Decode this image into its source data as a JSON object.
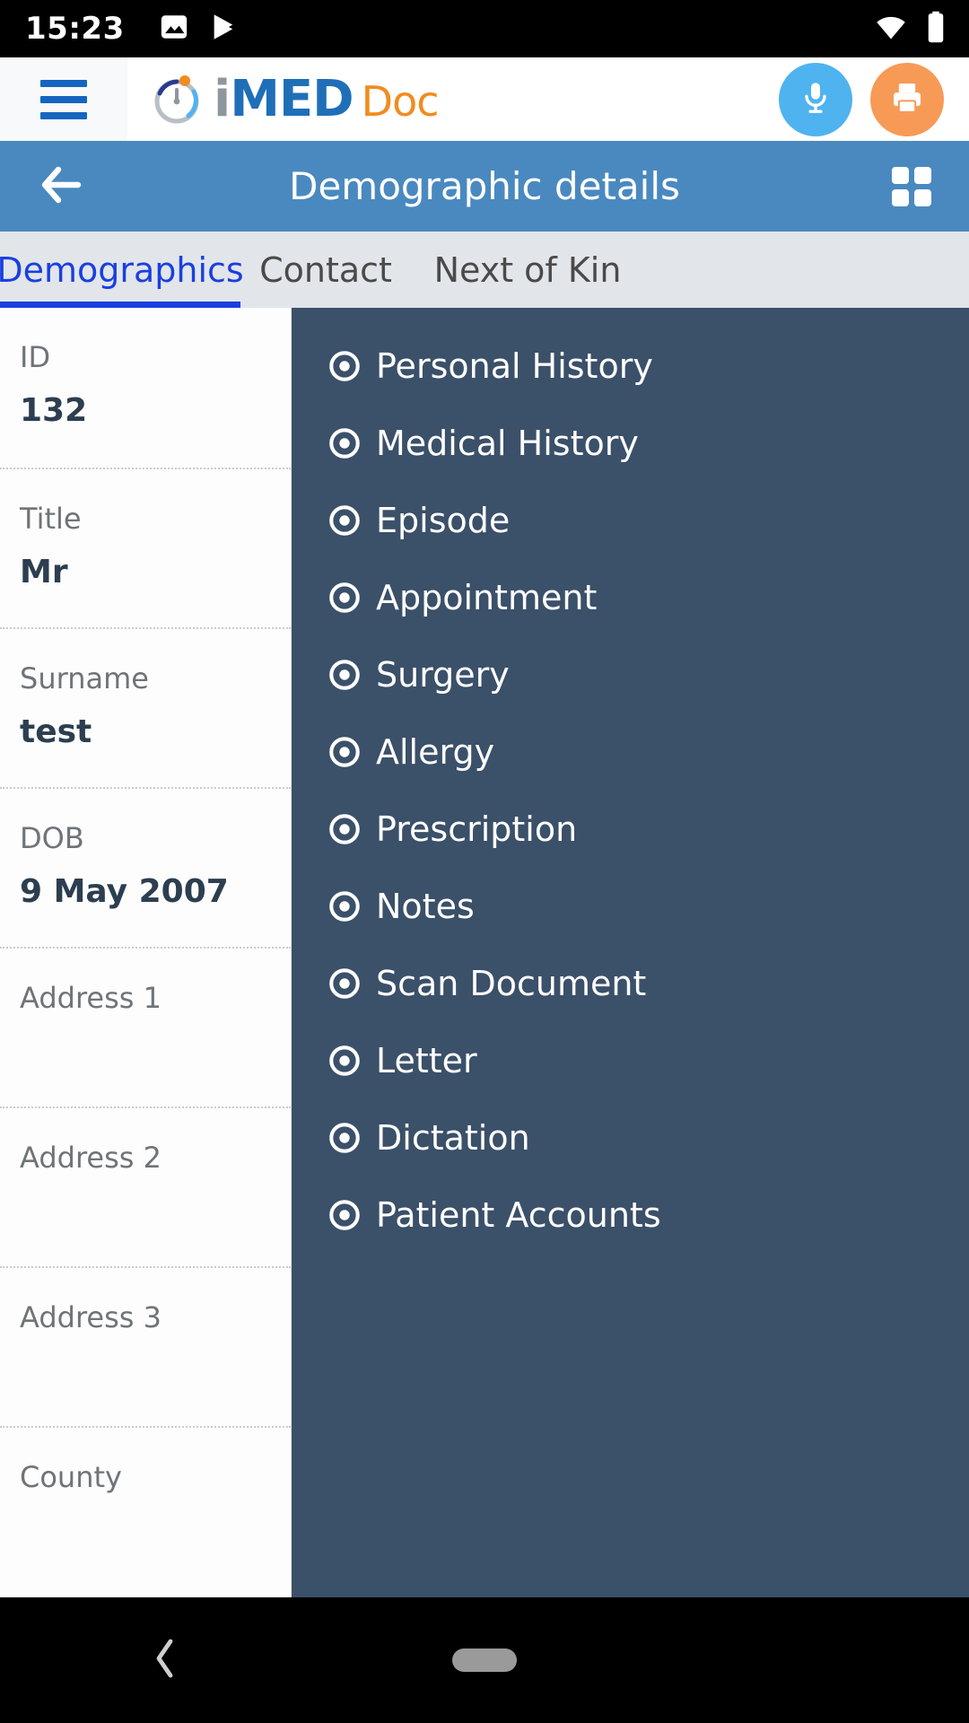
{
  "status_bar": {
    "time": "15:23",
    "icons_left": [
      "image-icon",
      "play-store-icon"
    ],
    "icons_right": [
      "wifi-icon",
      "battery-icon"
    ]
  },
  "app_bar": {
    "menu_icon": "hamburger-menu-icon",
    "logo": {
      "mark": "imeddoc-logo-mark",
      "text_i": "i",
      "text_med": "MED",
      "text_doc": "Doc"
    },
    "actions": [
      {
        "name": "microphone-button",
        "icon": "microphone-icon",
        "color": "#4fb3f0"
      },
      {
        "name": "print-button",
        "icon": "printer-icon",
        "color": "#f79a56"
      }
    ]
  },
  "title_bar": {
    "back_icon": "back-arrow-icon",
    "title": "Demographic details",
    "grid_icon": "grid-view-icon",
    "background": "#4a89c0"
  },
  "tabs": {
    "active_index": 0,
    "active_color": "#1a3fe0",
    "items": [
      {
        "label": "Demographics"
      },
      {
        "label": "Contact"
      },
      {
        "label": "Next of Kin"
      }
    ]
  },
  "demographics_form": {
    "fields": [
      {
        "label": "ID",
        "value": "132"
      },
      {
        "label": "Title",
        "value": "Mr"
      },
      {
        "label": "Surname",
        "value": "test"
      },
      {
        "label": "DOB",
        "value": "9 May 2007"
      },
      {
        "label": "Address 1",
        "value": ""
      },
      {
        "label": "Address 2",
        "value": ""
      },
      {
        "label": "Address 3",
        "value": ""
      },
      {
        "label": "County",
        "value": ""
      }
    ]
  },
  "side_menu": {
    "background": "#3b5069",
    "bullet_icon": "circle-dot-icon",
    "items": [
      {
        "label": "Personal History"
      },
      {
        "label": "Medical History"
      },
      {
        "label": "Episode"
      },
      {
        "label": "Appointment"
      },
      {
        "label": "Surgery"
      },
      {
        "label": "Allergy"
      },
      {
        "label": "Prescription"
      },
      {
        "label": "Notes"
      },
      {
        "label": "Scan Document"
      },
      {
        "label": "Letter"
      },
      {
        "label": "Dictation"
      },
      {
        "label": "Patient Accounts"
      }
    ]
  },
  "nav_bar": {
    "back_icon": "nav-back-icon",
    "home_icon": "nav-home-pill-icon"
  }
}
